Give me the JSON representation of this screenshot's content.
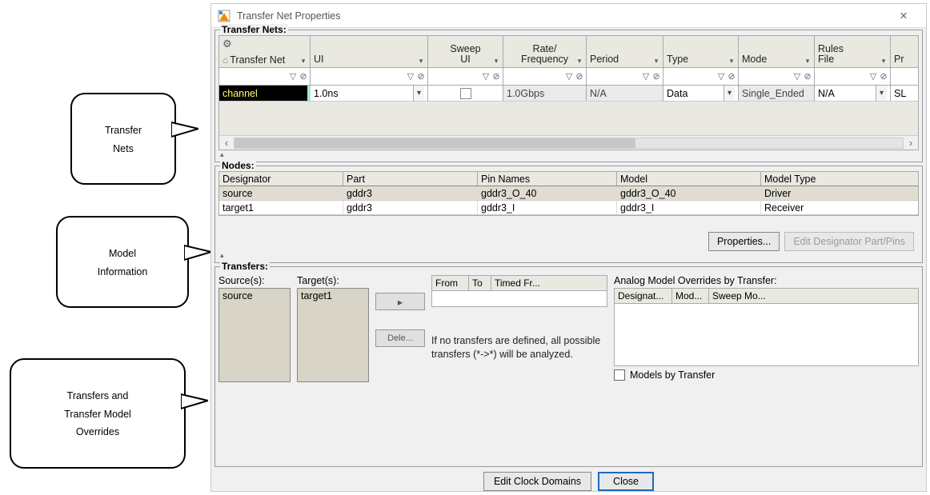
{
  "window": {
    "title": "Transfer Net Properties"
  },
  "callouts": {
    "transferNets": "Transfer\nNets",
    "modelInfo": "Model\nInformation",
    "transfers": "Transfers and\nTransfer Model\nOverrides"
  },
  "panels": {
    "transferNets": "Transfer Nets:",
    "nodes": "Nodes:",
    "transfers": "Transfers:"
  },
  "tnGrid": {
    "col0": "Transfer Net",
    "col1": "UI",
    "col2a": "Sweep",
    "col2b": "UI",
    "col3a": "Rate/",
    "col3b": "Frequency",
    "col4": "Period",
    "col5": "Type",
    "col6": "Mode",
    "col7a": "Rules",
    "col7b": "File",
    "col8": "Pr",
    "row": {
      "name": "channel",
      "ui": "1.0ns",
      "rate": "1.0Gbps",
      "period": "N/A",
      "type": "Data",
      "mode": "Single_Ended",
      "rules": "N/A",
      "pr": "SL"
    }
  },
  "nodes": {
    "h0": "Designator",
    "h1": "Part",
    "h2": "Pin Names",
    "h3": "Model",
    "h4": "Model Type",
    "rows": [
      {
        "d": "source",
        "p": "gddr3",
        "pn": "gddr3_O_40",
        "m": "gddr3_O_40",
        "mt": "Driver"
      },
      {
        "d": "target1",
        "p": "gddr3",
        "pn": "gddr3_I",
        "m": "gddr3_I",
        "mt": "Receiver"
      }
    ],
    "btnProps": "Properties...",
    "btnEdit": "Edit Designator Part/Pins"
  },
  "transfers": {
    "sourcesLbl": "Source(s):",
    "targetsLbl": "Target(s):",
    "sourceItem": "source",
    "targetItem": "target1",
    "moveBtn": "▸",
    "delBtn": "Dele...",
    "ft0": "From",
    "ft1": "To",
    "ft2": "Timed Fr...",
    "note1": "If no transfers are defined, all possible",
    "note2": "transfers (*->*) will be analyzed.",
    "ovLabel": "Analog Model Overrides by Transfer:",
    "ov0": "Designat...",
    "ov1": "Mod...",
    "ov2": "Sweep Mo...",
    "chkLabel": "Models by Transfer"
  },
  "footer": {
    "editClock": "Edit Clock Domains",
    "close": "Close"
  }
}
